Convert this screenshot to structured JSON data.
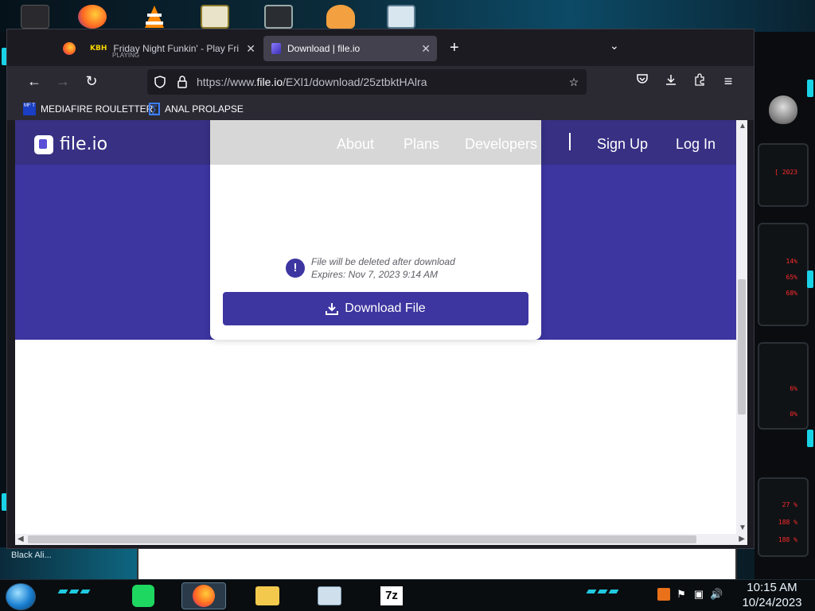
{
  "desktop": {
    "label": "Black Ali...",
    "hud_readouts": [
      "[ 2023",
      "14%",
      "65%",
      "68%",
      "6%",
      "0%",
      "27 %",
      "188 %",
      "188 %"
    ]
  },
  "taskbar": {
    "time": "10:15 AM",
    "date": "10/24/2023"
  },
  "browser": {
    "tabs": [
      {
        "title": "Friday Night Funkin' - Play Fri",
        "subtitle": "PLAYING",
        "icon": "kbh-logo",
        "badge": "KBH"
      },
      {
        "title": "Download | file.io",
        "icon": "fileio-icon",
        "active": true
      }
    ],
    "url_prefix": "https://www.",
    "url_domain": "file.io",
    "url_path": "/EXl1/download/25ztbktHAlra",
    "bookmarks": [
      {
        "label": "MEDIAFIRE ROULETTER",
        "icon": "mft-icon",
        "icon_text": "MF T"
      },
      {
        "label": "ANAL PROLAPSE",
        "icon": "sigma-icon",
        "icon_text": "∑"
      }
    ]
  },
  "site": {
    "logo_text": "file.io",
    "nav": {
      "about": "About",
      "plans": "Plans",
      "developers": "Developers",
      "sign_up": "Sign Up",
      "log_in": "Log In"
    },
    "notice_line1": "File will be deleted after download",
    "notice_line2": "Expires: Nov 7, 2023 9:14 AM",
    "download_label": "Download File"
  },
  "colors": {
    "brand": "#3d35a0",
    "header": "#373083",
    "browser_dark": "#1c1b22",
    "toolbar": "#2b2a33",
    "hud_red": "#ff2a2a",
    "cyan": "#19d3e6"
  }
}
